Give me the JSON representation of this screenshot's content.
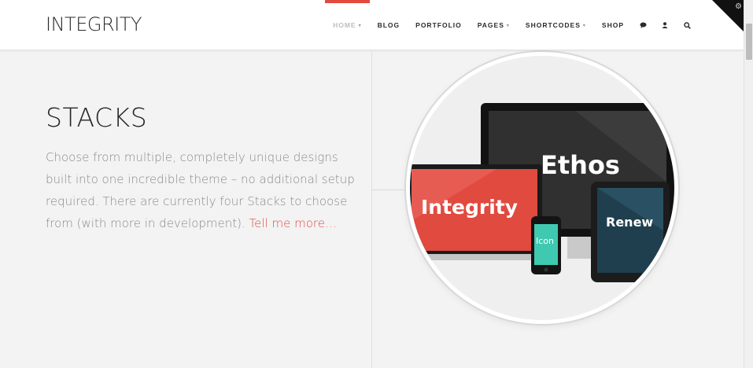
{
  "header": {
    "logo": "INTEGRITY",
    "nav": [
      {
        "label": "HOME",
        "active": true,
        "caret": true
      },
      {
        "label": "BLOG",
        "active": false,
        "caret": false
      },
      {
        "label": "PORTFOLIO",
        "active": false,
        "caret": false
      },
      {
        "label": "PAGES",
        "active": false,
        "caret": true
      },
      {
        "label": "SHORTCODES",
        "active": false,
        "caret": true
      },
      {
        "label": "SHOP",
        "active": false,
        "caret": false
      }
    ],
    "icons": [
      "comment-icon",
      "user-icon",
      "search-icon"
    ],
    "accent": "#e4493f"
  },
  "hero": {
    "title": "STACKS",
    "description": "Choose from multiple, completely unique designs built into one incredible theme – no additional setup required. There are currently four Stacks to choose from (with more in development).",
    "link_text": "Tell me more…"
  },
  "devices": {
    "monitor": "Ethos",
    "laptop": "Integrity",
    "tablet": "Renew",
    "phone": "Icon"
  }
}
